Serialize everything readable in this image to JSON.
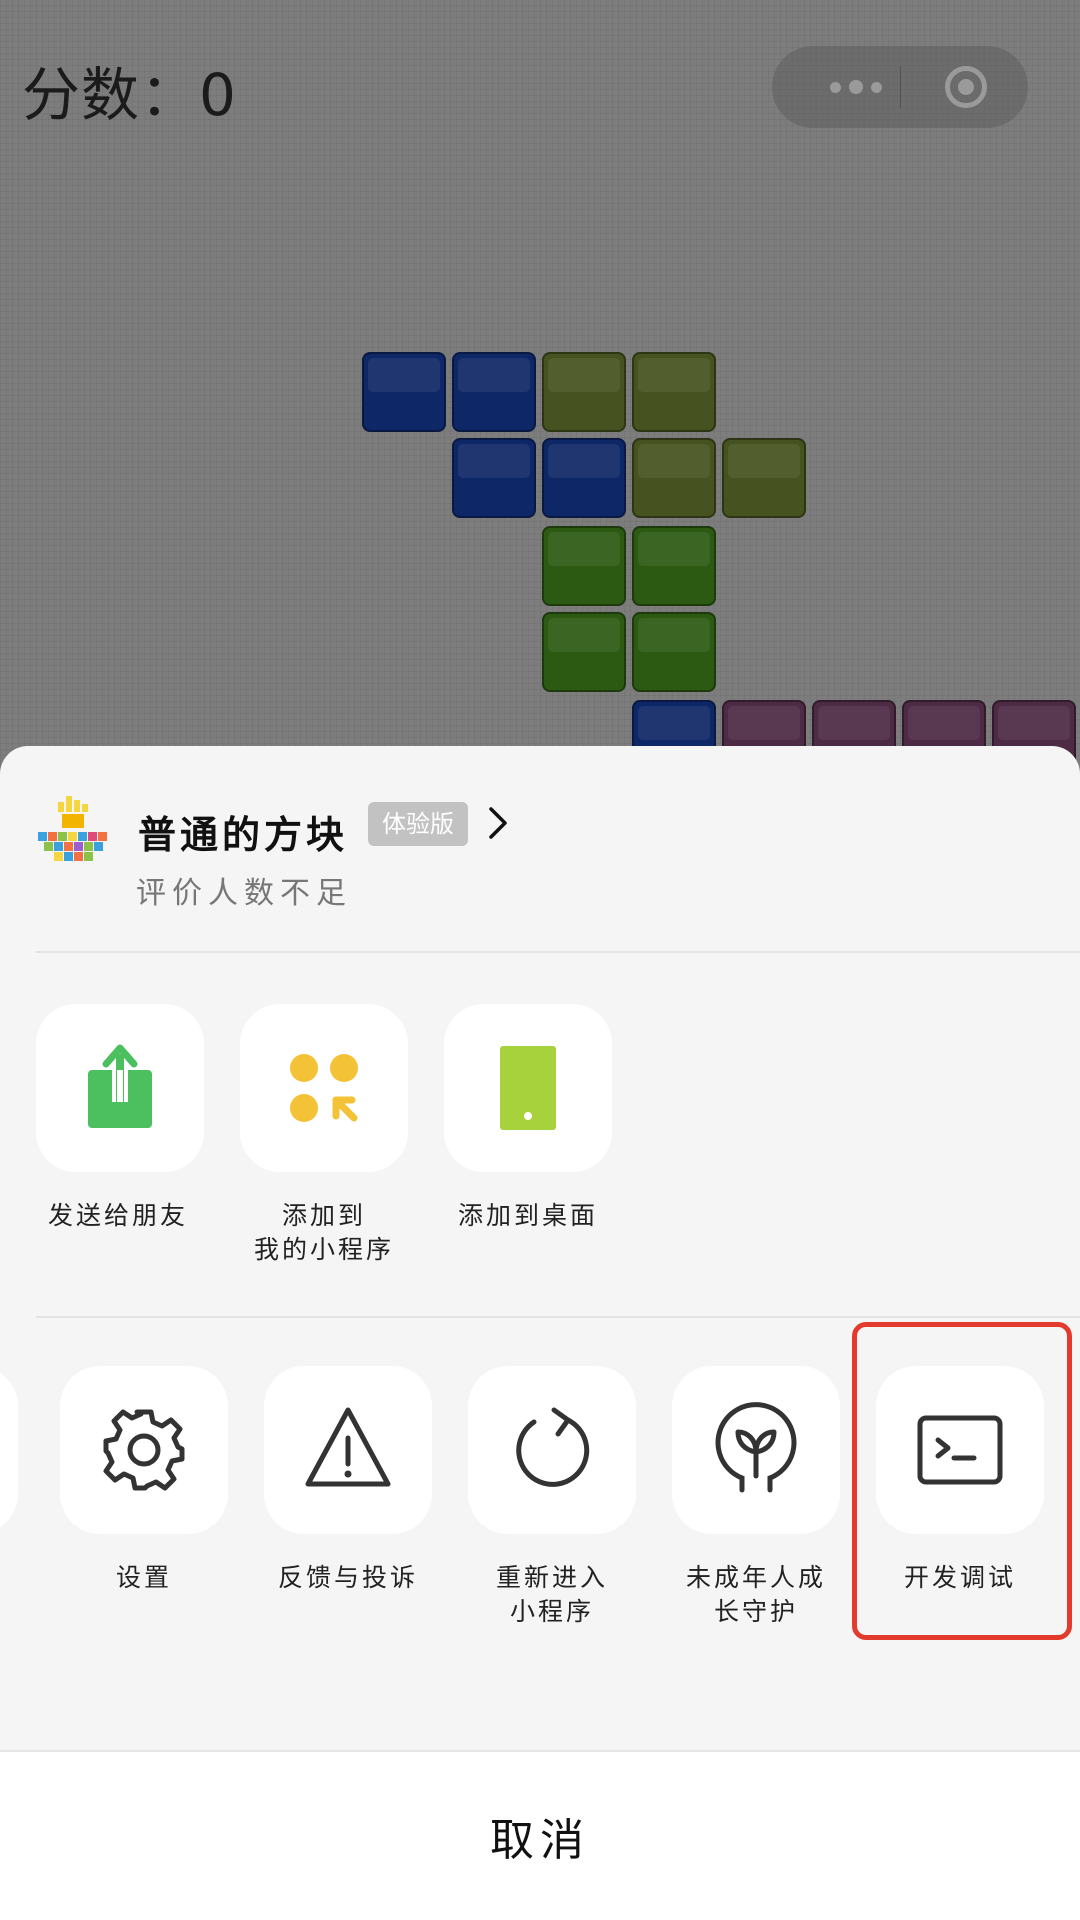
{
  "game": {
    "score_text": "分数：0"
  },
  "sheet": {
    "app_name": "普通的方块",
    "badge": "体验版",
    "rating": "评价人数不足",
    "row1": [
      {
        "label": "发送给朋友",
        "icon": "share-icon"
      },
      {
        "label": "添加到\n我的小程序",
        "icon": "add-to-my-miniprogram-icon"
      },
      {
        "label": "添加到桌面",
        "icon": "add-to-desktop-icon"
      }
    ],
    "row2": [
      {
        "label": "设置",
        "icon": "gear-icon"
      },
      {
        "label": "反馈与投诉",
        "icon": "warning-icon"
      },
      {
        "label": "重新进入\n小程序",
        "icon": "refresh-icon"
      },
      {
        "label": "未成年人成\n长守护",
        "icon": "sprout-icon"
      },
      {
        "label": "开发调试",
        "icon": "terminal-icon"
      }
    ],
    "cancel": "取消"
  },
  "colors": {
    "highlight": "#e23b2e",
    "share_green": "#4cbf5f",
    "mini_yellow": "#f3c236",
    "desktop_green": "#a8d23c"
  }
}
